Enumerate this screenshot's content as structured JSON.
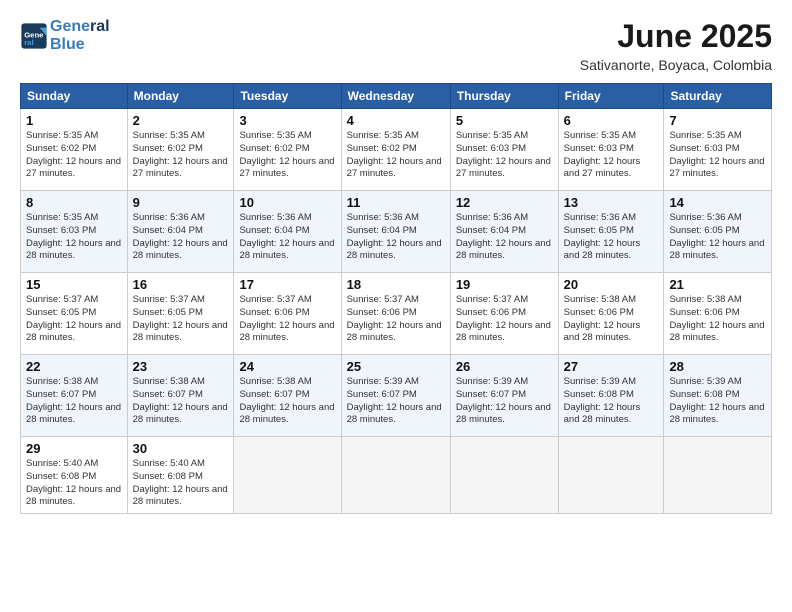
{
  "header": {
    "logo_line1": "General",
    "logo_line2": "Blue",
    "month": "June 2025",
    "location": "Sativanorte, Boyaca, Colombia"
  },
  "days_of_week": [
    "Sunday",
    "Monday",
    "Tuesday",
    "Wednesday",
    "Thursday",
    "Friday",
    "Saturday"
  ],
  "weeks": [
    [
      {
        "day": "1",
        "sunrise": "5:35 AM",
        "sunset": "6:02 PM",
        "daylight": "12 hours and 27 minutes."
      },
      {
        "day": "2",
        "sunrise": "5:35 AM",
        "sunset": "6:02 PM",
        "daylight": "12 hours and 27 minutes."
      },
      {
        "day": "3",
        "sunrise": "5:35 AM",
        "sunset": "6:02 PM",
        "daylight": "12 hours and 27 minutes."
      },
      {
        "day": "4",
        "sunrise": "5:35 AM",
        "sunset": "6:02 PM",
        "daylight": "12 hours and 27 minutes."
      },
      {
        "day": "5",
        "sunrise": "5:35 AM",
        "sunset": "6:03 PM",
        "daylight": "12 hours and 27 minutes."
      },
      {
        "day": "6",
        "sunrise": "5:35 AM",
        "sunset": "6:03 PM",
        "daylight": "12 hours and 27 minutes."
      },
      {
        "day": "7",
        "sunrise": "5:35 AM",
        "sunset": "6:03 PM",
        "daylight": "12 hours and 27 minutes."
      }
    ],
    [
      {
        "day": "8",
        "sunrise": "5:35 AM",
        "sunset": "6:03 PM",
        "daylight": "12 hours and 28 minutes."
      },
      {
        "day": "9",
        "sunrise": "5:36 AM",
        "sunset": "6:04 PM",
        "daylight": "12 hours and 28 minutes."
      },
      {
        "day": "10",
        "sunrise": "5:36 AM",
        "sunset": "6:04 PM",
        "daylight": "12 hours and 28 minutes."
      },
      {
        "day": "11",
        "sunrise": "5:36 AM",
        "sunset": "6:04 PM",
        "daylight": "12 hours and 28 minutes."
      },
      {
        "day": "12",
        "sunrise": "5:36 AM",
        "sunset": "6:04 PM",
        "daylight": "12 hours and 28 minutes."
      },
      {
        "day": "13",
        "sunrise": "5:36 AM",
        "sunset": "6:05 PM",
        "daylight": "12 hours and 28 minutes."
      },
      {
        "day": "14",
        "sunrise": "5:36 AM",
        "sunset": "6:05 PM",
        "daylight": "12 hours and 28 minutes."
      }
    ],
    [
      {
        "day": "15",
        "sunrise": "5:37 AM",
        "sunset": "6:05 PM",
        "daylight": "12 hours and 28 minutes."
      },
      {
        "day": "16",
        "sunrise": "5:37 AM",
        "sunset": "6:05 PM",
        "daylight": "12 hours and 28 minutes."
      },
      {
        "day": "17",
        "sunrise": "5:37 AM",
        "sunset": "6:06 PM",
        "daylight": "12 hours and 28 minutes."
      },
      {
        "day": "18",
        "sunrise": "5:37 AM",
        "sunset": "6:06 PM",
        "daylight": "12 hours and 28 minutes."
      },
      {
        "day": "19",
        "sunrise": "5:37 AM",
        "sunset": "6:06 PM",
        "daylight": "12 hours and 28 minutes."
      },
      {
        "day": "20",
        "sunrise": "5:38 AM",
        "sunset": "6:06 PM",
        "daylight": "12 hours and 28 minutes."
      },
      {
        "day": "21",
        "sunrise": "5:38 AM",
        "sunset": "6:06 PM",
        "daylight": "12 hours and 28 minutes."
      }
    ],
    [
      {
        "day": "22",
        "sunrise": "5:38 AM",
        "sunset": "6:07 PM",
        "daylight": "12 hours and 28 minutes."
      },
      {
        "day": "23",
        "sunrise": "5:38 AM",
        "sunset": "6:07 PM",
        "daylight": "12 hours and 28 minutes."
      },
      {
        "day": "24",
        "sunrise": "5:38 AM",
        "sunset": "6:07 PM",
        "daylight": "12 hours and 28 minutes."
      },
      {
        "day": "25",
        "sunrise": "5:39 AM",
        "sunset": "6:07 PM",
        "daylight": "12 hours and 28 minutes."
      },
      {
        "day": "26",
        "sunrise": "5:39 AM",
        "sunset": "6:07 PM",
        "daylight": "12 hours and 28 minutes."
      },
      {
        "day": "27",
        "sunrise": "5:39 AM",
        "sunset": "6:08 PM",
        "daylight": "12 hours and 28 minutes."
      },
      {
        "day": "28",
        "sunrise": "5:39 AM",
        "sunset": "6:08 PM",
        "daylight": "12 hours and 28 minutes."
      }
    ],
    [
      {
        "day": "29",
        "sunrise": "5:40 AM",
        "sunset": "6:08 PM",
        "daylight": "12 hours and 28 minutes."
      },
      {
        "day": "30",
        "sunrise": "5:40 AM",
        "sunset": "6:08 PM",
        "daylight": "12 hours and 28 minutes."
      },
      null,
      null,
      null,
      null,
      null
    ]
  ]
}
